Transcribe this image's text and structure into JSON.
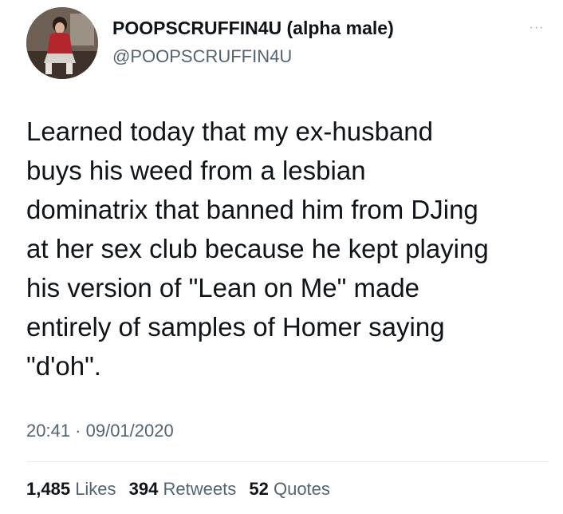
{
  "author": {
    "display_name": "POOPSCRUFFIN4U (alpha male)",
    "handle": "@POOPSCRUFFIN4U",
    "avatar_icon": "profile-photo"
  },
  "more_icon": "more-options-icon",
  "tweet": {
    "lines": [
      "Learned today that my ex-husband",
      "buys his weed from a lesbian",
      "dominatrix that banned him from DJing",
      "at her sex club because he kept playing",
      "his version of \"Lean on Me\" made",
      "entirely of samples of Homer saying",
      "\"d'oh\"."
    ],
    "timestamp": "20:41 · 09/01/2020"
  },
  "stats": {
    "likes_count": "1,485",
    "likes_label": "Likes",
    "retweets_count": "394",
    "retweets_label": "Retweets",
    "quotes_count": "52",
    "quotes_label": "Quotes"
  }
}
